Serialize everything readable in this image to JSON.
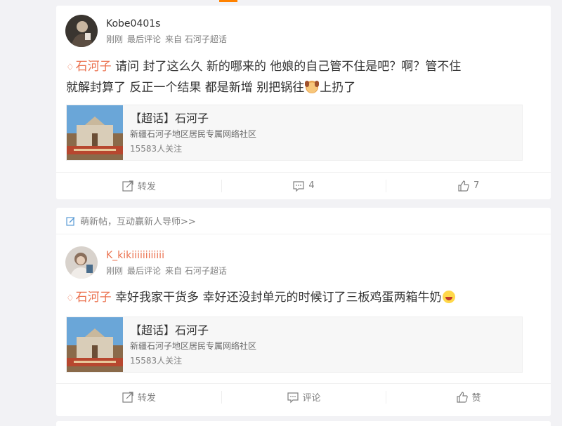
{
  "posts": [
    {
      "username": "Kobe0401s",
      "username_color": "#333333",
      "time": "刚刚",
      "meta_label": "最后评论",
      "source": "来自 石河子超话",
      "topic_tag": "石河子",
      "text_line1": " 请问 封了这么久 新的哪来的 他娘的自己管不住是吧？啊？管不住",
      "text_line2a": "就解封算了 反正一个结果 都是新增 别把锅往",
      "text_line2b": "上扔了",
      "topic_card": {
        "title": "【超话】石河子",
        "desc": "新疆石河子地区居民专属网络社区",
        "follow": "15583人关注"
      },
      "actions": {
        "repost": "转发",
        "comment": "4",
        "like": "7"
      }
    },
    {
      "username": "K_kikiiiiiiiiiiii",
      "username_color": "#eb7350",
      "time": "刚刚",
      "meta_label": "最后评论",
      "source": "来自 石河子超话",
      "topic_tag": "石河子",
      "text_line1": " 幸好我家干货多 幸好还没封单元的时候订了三板鸡蛋两箱牛奶",
      "topic_card": {
        "title": "【超话】石河子",
        "desc": "新疆石河子地区居民专属网络社区",
        "follow": "15583人关注"
      },
      "actions": {
        "repost": "转发",
        "comment": "评论",
        "like": "赞"
      }
    }
  ],
  "newbie_banner": "萌新帖，互动赢新人导师>>",
  "colors": {
    "accent": "#ff8200",
    "link": "#eb7350",
    "background": "#f2f2f5"
  }
}
